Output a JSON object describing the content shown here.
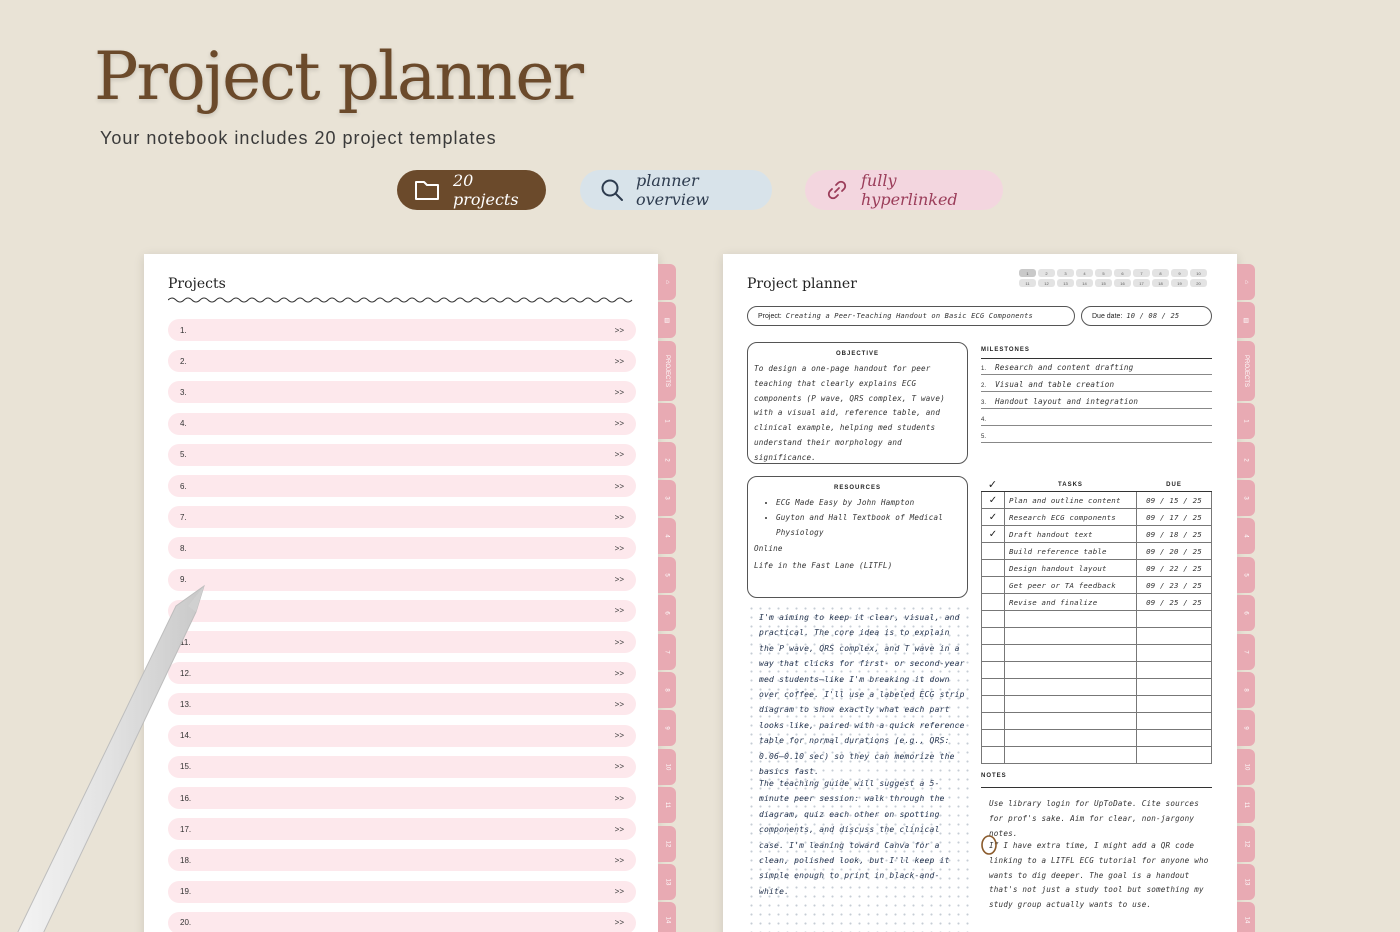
{
  "hero": {
    "title": "Project planner",
    "subtitle": "Your notebook includes 20 project templates"
  },
  "pills": {
    "projects": "20 projects",
    "overview": "planner overview",
    "linked": "fully hyperlinked"
  },
  "colors": {
    "brown": "#6b4a2b",
    "pink_row": "#fde8ec",
    "tab_pink": "#e8aab3",
    "ink": "#22324d"
  },
  "tabs": [
    "⌂",
    "▤",
    "PROJECTS",
    "1",
    "2",
    "3",
    "4",
    "5",
    "6",
    "7",
    "8",
    "9",
    "10",
    "11",
    "12",
    "13",
    "14"
  ],
  "left_page": {
    "title": "Projects",
    "arrow": ">>",
    "rows": [
      "1.",
      "2.",
      "3.",
      "4.",
      "5.",
      "6.",
      "7.",
      "8.",
      "9.",
      "10.",
      "11.",
      "12.",
      "13.",
      "14.",
      "15.",
      "16.",
      "17.",
      "18.",
      "19.",
      "20."
    ]
  },
  "right_page": {
    "title": "Project planner",
    "nav_numbers": [
      "1",
      "2",
      "3",
      "4",
      "5",
      "6",
      "7",
      "8",
      "9",
      "10",
      "11",
      "12",
      "13",
      "14",
      "15",
      "16",
      "17",
      "18",
      "19",
      "20"
    ],
    "project_label": "Project:",
    "project_value": "Creating a Peer-Teaching Handout on Basic ECG Components",
    "due_label": "Due date:",
    "due_value": "10 / 08 / 25",
    "objective": {
      "title": "OBJECTIVE",
      "text": "To design a one-page handout for peer teaching that clearly explains ECG components (P wave, QRS complex, T wave) with a visual aid, reference table, and clinical example, helping med students understand their morphology and significance."
    },
    "resources": {
      "title": "RESOURCES",
      "bullets": [
        "ECG Made Easy by John Hampton",
        "Guyton and Hall Textbook of Medical Physiology"
      ],
      "online_label": "Online",
      "online_item": "Life in the Fast Lane (LITFL)"
    },
    "milestones": {
      "title": "MILESTONES",
      "items": [
        {
          "n": "1.",
          "text": "Research and content drafting"
        },
        {
          "n": "2.",
          "text": "Visual and table creation"
        },
        {
          "n": "3.",
          "text": "Handout layout and integration"
        },
        {
          "n": "4.",
          "text": ""
        },
        {
          "n": "5.",
          "text": ""
        }
      ]
    },
    "tasks": {
      "check_header": "✓",
      "title": "TASKS",
      "due_title": "DUE",
      "rows": [
        {
          "check": "✓",
          "task": "Plan and outline content",
          "due": "09 / 15 / 25"
        },
        {
          "check": "✓",
          "task": "Research ECG components",
          "due": "09 / 17 / 25"
        },
        {
          "check": "✓",
          "task": "Draft handout text",
          "due": "09 / 18 / 25"
        },
        {
          "check": "",
          "task": "Build reference table",
          "due": "09 / 20 / 25"
        },
        {
          "check": "",
          "task": "Design handout layout",
          "due": "09 / 22 / 25"
        },
        {
          "check": "",
          "task": "Get peer or TA feedback",
          "due": "09 / 23 / 25"
        },
        {
          "check": "",
          "task": "Revise and finalize",
          "due": "09 / 25 / 25"
        },
        {
          "check": "",
          "task": "",
          "due": ""
        },
        {
          "check": "",
          "task": "",
          "due": ""
        },
        {
          "check": "",
          "task": "",
          "due": ""
        },
        {
          "check": "",
          "task": "",
          "due": ""
        },
        {
          "check": "",
          "task": "",
          "due": ""
        },
        {
          "check": "",
          "task": "",
          "due": ""
        },
        {
          "check": "",
          "task": "",
          "due": ""
        },
        {
          "check": "",
          "task": "",
          "due": ""
        },
        {
          "check": "",
          "task": "",
          "due": ""
        }
      ]
    },
    "journal": {
      "p1": "I'm aiming to keep it clear, visual, and practical. The core idea is to explain the P wave, QRS complex, and T wave in a way that clicks for first- or second-year med students—like I'm breaking it down over coffee. I'll use a labeled ECG strip diagram to show exactly what each part looks like, paired with a quick reference table for normal durations (e.g., QRS: 0.06–0.10 sec) so they can memorize the basics fast.",
      "p2": "The teaching guide will suggest a 5-minute peer session: walk through the diagram, quiz each other on spotting components, and discuss the clinical case. I'm leaning toward Canva for a clean, polished look, but I'll keep it simple enough to print in black-and-white."
    },
    "notes": {
      "title": "NOTES",
      "p1": "Use library login for UpToDate. Cite sources for prof's sake. Aim for clear, non-jargony notes.",
      "p2": "If I have extra time, I might add a QR code linking to a LITFL ECG tutorial for anyone who wants to dig deeper. The goal is a handout that's not just a study tool but something my study group actually wants to use."
    }
  }
}
